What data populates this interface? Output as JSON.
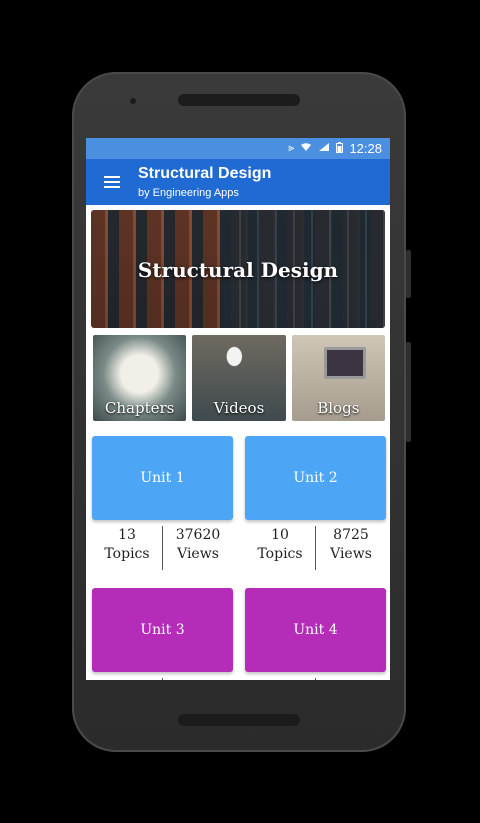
{
  "status_bar": {
    "time": "12:28",
    "icons": [
      "vibrate-icon",
      "wifi-icon",
      "signal-icon",
      "battery-icon"
    ]
  },
  "app_bar": {
    "title": "Structural Design",
    "subtitle": "by Engineering Apps",
    "menu_icon": "hamburger-menu-icon"
  },
  "banner": {
    "title": "Structural Design"
  },
  "categories": [
    {
      "label": "Chapters",
      "image": "open-book-photo"
    },
    {
      "label": "Videos",
      "image": "lecture-hall-photo"
    },
    {
      "label": "Blogs",
      "image": "laptop-desk-photo"
    }
  ],
  "units": [
    {
      "name": "Unit 1",
      "color": "#4da6f5",
      "topics": "13",
      "topics_label": "Topics",
      "views": "37620",
      "views_label": "Views"
    },
    {
      "name": "Unit 2",
      "color": "#4da6f5",
      "topics": "10",
      "topics_label": "Topics",
      "views": "8725",
      "views_label": "Views"
    },
    {
      "name": "Unit 3",
      "color": "#b42cb8",
      "topics": "",
      "topics_label": "",
      "views": "",
      "views_label": ""
    },
    {
      "name": "Unit 4",
      "color": "#b42cb8",
      "topics": "",
      "topics_label": "",
      "views": "",
      "views_label": ""
    }
  ],
  "colors": {
    "status_bar": "#4a8fe0",
    "app_bar": "#1f6ad3",
    "unit_blue": "#4da6f5",
    "unit_purple": "#b42cb8"
  }
}
